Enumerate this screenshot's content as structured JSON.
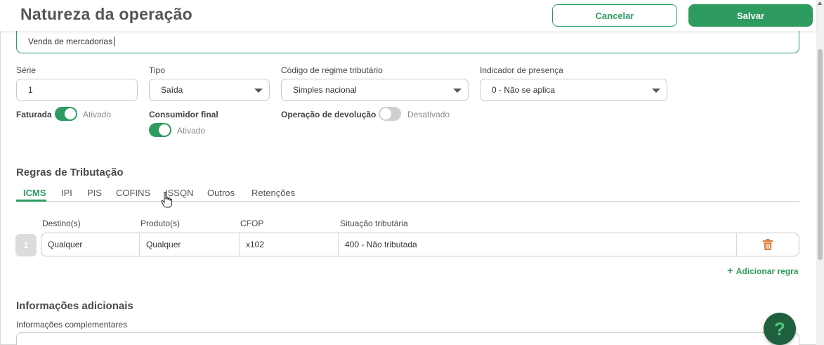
{
  "header": {
    "title": "Natureza da operação",
    "cancel_label": "Cancelar",
    "save_label": "Salvar"
  },
  "description": {
    "value": "Venda de mercadorias"
  },
  "fields": {
    "serie": {
      "label": "Série",
      "value": "1"
    },
    "tipo": {
      "label": "Tipo",
      "value": "Saída"
    },
    "regime": {
      "label": "Código de regime tributário",
      "value": "Simples nacional"
    },
    "presenca": {
      "label": "Indicador de presença",
      "value": "0 - Não se aplica"
    }
  },
  "toggles": {
    "faturada": {
      "label": "Faturada",
      "state": "Ativado",
      "on": true
    },
    "consumidor": {
      "label": "Consumidor final",
      "state": "Ativado",
      "on": true
    },
    "devolucao": {
      "label": "Operação de devolução",
      "state": "Desativado",
      "on": false
    }
  },
  "tax_rules": {
    "title": "Regras de Tributação",
    "tabs": [
      "ICMS",
      "IPI",
      "PIS",
      "COFINS",
      "ISSQN",
      "Outros",
      "Retenções"
    ],
    "active_tab": "ICMS",
    "columns": [
      "Destino(s)",
      "Produto(s)",
      "CFOP",
      "Situação tributária"
    ],
    "rows": [
      {
        "index": "1",
        "destino": "Qualquer",
        "produto": "Qualquer",
        "cfop": "x102",
        "situacao": "400 - Não tributada"
      }
    ],
    "add_label": "Adicionar regra",
    "delete_icon": "trash-icon"
  },
  "additional": {
    "title": "Informações adicionais",
    "complementary_label": "Informações complementares"
  },
  "help": {
    "label": "?"
  },
  "colors": {
    "accent": "#2e9b5f",
    "danger": "#e07a3a",
    "help_bg": "#1f5f3d"
  }
}
